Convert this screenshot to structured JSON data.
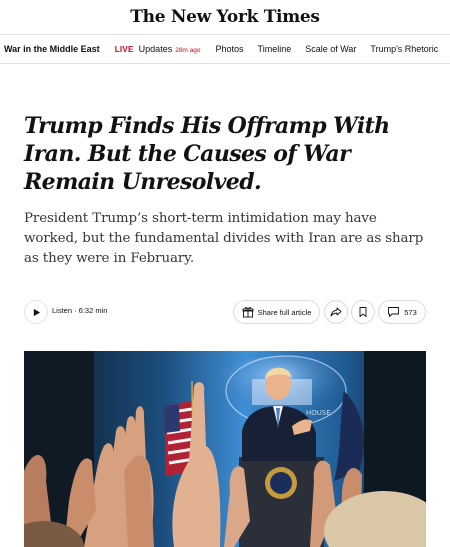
{
  "masthead": {
    "logo_text": "The New York Times"
  },
  "subnav": {
    "section": "War in the Middle East",
    "live_label": "LIVE",
    "updates_label": "Updates",
    "updates_ago": "28m ago",
    "links": [
      "Photos",
      "Timeline",
      "Scale of War",
      "Trump's Rhetoric"
    ]
  },
  "article": {
    "headline": "Trump Finds His Offramp With Iran. But the Causes of War Remain Unresolved.",
    "dek": "President Trump’s short-term intimidation may have worked, but the fundamental divides with Iran are as sharp as they were in February."
  },
  "toolbar": {
    "listen_label": "Listen · 6:32 min",
    "share_full_label": "Share full article",
    "comments_count": "573",
    "icons": [
      "play-icon",
      "gift-icon",
      "share-arrow-icon",
      "bookmark-icon",
      "comment-icon"
    ]
  },
  "photo": {
    "seal_text": "HOUSE"
  },
  "colors": {
    "live": "#d0021b",
    "text": "#121212",
    "dek": "#363636",
    "border": "#dcdcdc"
  }
}
